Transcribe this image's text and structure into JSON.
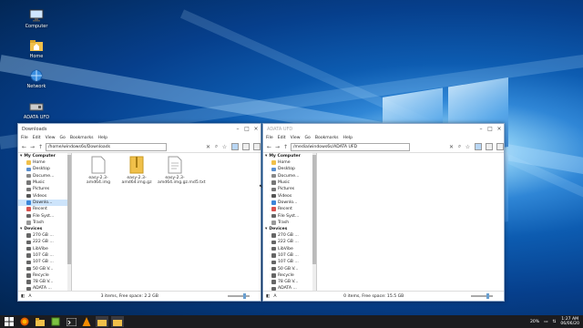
{
  "desktop": {
    "icons": [
      {
        "label": "Computer",
        "icon": "computer-icon"
      },
      {
        "label": "Home",
        "icon": "home-folder-icon"
      },
      {
        "label": "Network",
        "icon": "network-icon"
      },
      {
        "label": "ADATA UFD",
        "icon": "usb-drive-icon"
      }
    ]
  },
  "left_window": {
    "title": "Downloads",
    "menu": [
      "File",
      "Edit",
      "View",
      "Go",
      "Bookmarks",
      "Help"
    ],
    "path": "/home/windows6s/Downloads",
    "sidebar": {
      "my_computer": "My Computer",
      "places": [
        "Home",
        "Desktop",
        "Docume...",
        "Music",
        "Pictures",
        "Videos",
        "Downlo...",
        "Recent",
        "File Syst...",
        "Trash"
      ],
      "devices_header": "Devices",
      "devices": [
        "270 GB ...",
        "222 GB ...",
        "LibVibe",
        "107 GB ...",
        "107 GB ...",
        "50 GB V...",
        "Recycle",
        "78 GB V...",
        "ADATA ..."
      ]
    },
    "files": [
      {
        "name": "easy-2.3-amd64.img",
        "icon": "disk-image-file-icon"
      },
      {
        "name": "easy-2.3-amd64.img.gz",
        "icon": "archive-file-icon"
      },
      {
        "name": "easy-2.3-amd64.img.gz.md5.txt",
        "icon": "text-file-icon"
      }
    ],
    "status": "3 items, Free space: 2.2 GB"
  },
  "right_window": {
    "title": "ADATA UFD",
    "menu": [
      "File",
      "Edit",
      "View",
      "Go",
      "Bookmarks",
      "Help"
    ],
    "path": "/media/windows6s/ADATA UFD",
    "sidebar": {
      "my_computer": "My Computer",
      "places": [
        "Home",
        "Desktop",
        "Docume...",
        "Music",
        "Pictures",
        "Videos",
        "Downlo...",
        "Recent",
        "File Syst...",
        "Trash"
      ],
      "devices_header": "Devices",
      "devices": [
        "270 GB ...",
        "222 GB ...",
        "LibVibe",
        "107 GB ...",
        "107 GB ...",
        "50 GB V...",
        "Recycle",
        "78 GB V...",
        "ADATA ..."
      ]
    },
    "status": "0 items, Free space: 15.5 GB"
  },
  "taskbar": {
    "battery": "20%",
    "time": "1:27 AM",
    "date": "06/06/20"
  },
  "colors": {
    "folder": "#f0c04a",
    "accent": "#3d86d8",
    "taskbar": "#1c1c1f"
  }
}
